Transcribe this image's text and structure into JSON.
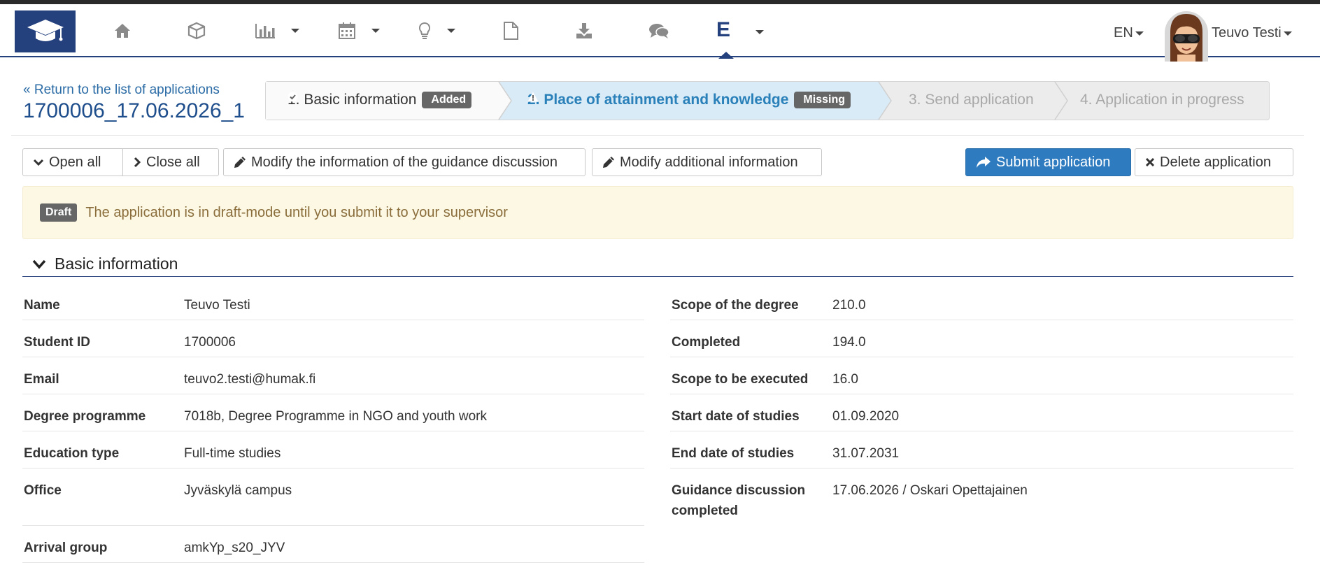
{
  "nav": {
    "items": [
      "home-icon",
      "cube-icon",
      "bar-chart-icon",
      "calendar-icon",
      "lightbulb-icon",
      "file-icon",
      "download-icon",
      "comments-icon"
    ],
    "active_label": "E",
    "language": "EN",
    "user_name": "Teuvo Testi"
  },
  "header": {
    "back_link": "« Return to the list of applications",
    "application_id": "1700006_17.06.2026_1"
  },
  "steps": [
    {
      "label": "1. Basic information",
      "badge": "Added",
      "state": "done"
    },
    {
      "label": "2. Place of attainment and knowledge",
      "badge": "Missing",
      "state": "active"
    },
    {
      "label": "3. Send application",
      "state": "pending"
    },
    {
      "label": "4. Application in progress",
      "state": "pending"
    }
  ],
  "toolbar": {
    "open_all": "Open all",
    "close_all": "Close all",
    "modify_guidance": "Modify the information of the guidance discussion",
    "modify_additional": "Modify additional information",
    "submit": "Submit application",
    "delete": "Delete application"
  },
  "alert": {
    "badge": "Draft",
    "text": "The application is in draft-mode until you submit it to your supervisor"
  },
  "section": {
    "title": "Basic information"
  },
  "details_left": [
    {
      "label": "Name",
      "value": "Teuvo Testi"
    },
    {
      "label": "Student ID",
      "value": "1700006"
    },
    {
      "label": "Email",
      "value": "teuvo2.testi@humak.fi"
    },
    {
      "label": "Degree programme",
      "value": "7018b, Degree Programme in NGO and youth work"
    },
    {
      "label": "Education type",
      "value": "Full-time studies"
    },
    {
      "label": "Office",
      "value": "Jyväskylä campus"
    },
    {
      "label": "Arrival group",
      "value": "amkYp_s20_JYV"
    }
  ],
  "details_right": [
    {
      "label": "Scope of the degree",
      "value": "210.0"
    },
    {
      "label": "Completed",
      "value": "194.0"
    },
    {
      "label": "Scope to be executed",
      "value": "16.0"
    },
    {
      "label": "Start date of studies",
      "value": "01.09.2020"
    },
    {
      "label": "End date of studies",
      "value": "31.07.2031"
    },
    {
      "label": "Guidance discussion",
      "label2": "completed",
      "value": "17.06.2026 / Oskari Opettajainen"
    }
  ],
  "colors": {
    "brand": "#24407d",
    "link": "#2a6ba6",
    "primary": "#2f7bbf",
    "active_step_bg": "#d9ebf7",
    "warning_bg": "#fcf8e3"
  }
}
